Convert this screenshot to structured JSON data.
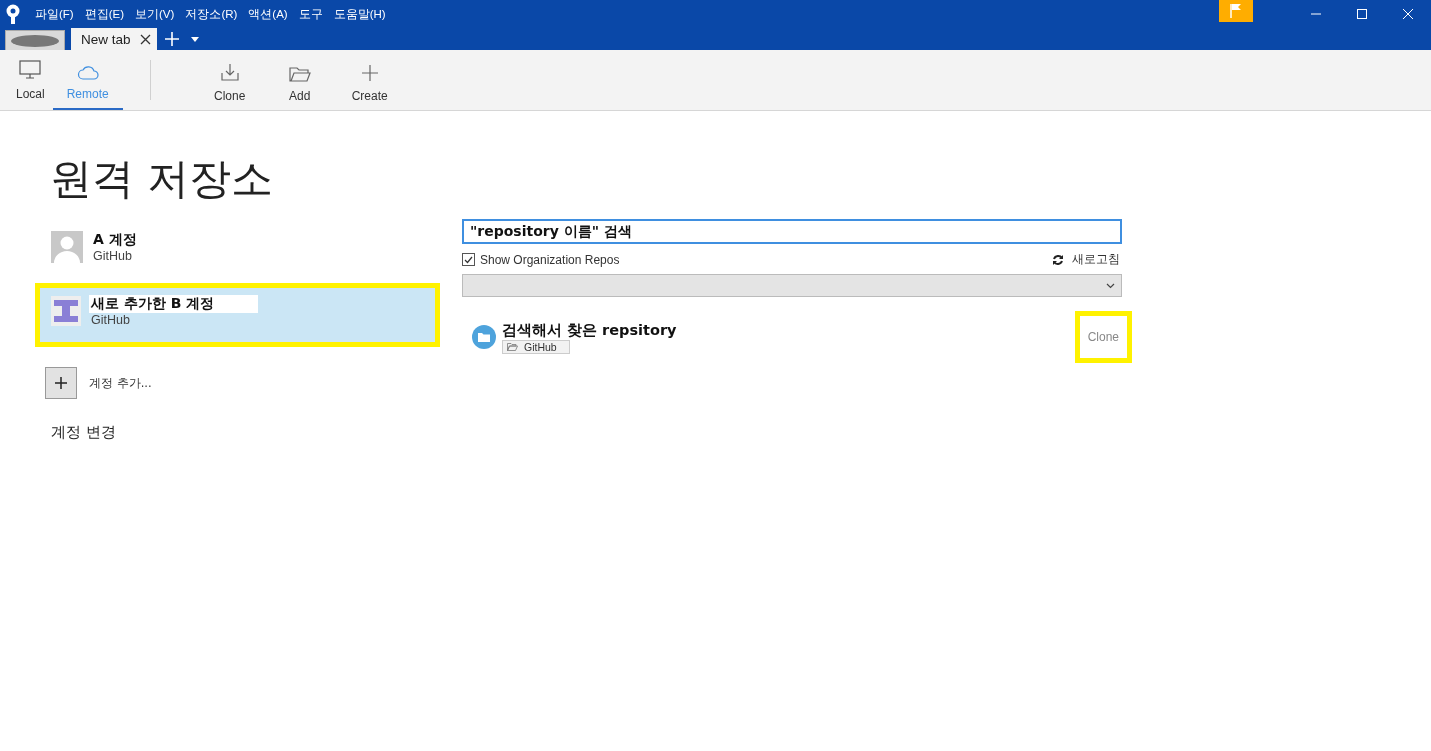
{
  "menu": [
    "파일(F)",
    "편집(E)",
    "보기(V)",
    "저장소(R)",
    "액션(A)",
    "도구",
    "도움말(H)"
  ],
  "tabs": [
    {
      "label": "New tab",
      "selected": true
    }
  ],
  "toolbar": {
    "views": [
      {
        "label": "Local",
        "selected": false
      },
      {
        "label": "Remote",
        "selected": true
      }
    ],
    "actions": [
      {
        "label": "Clone"
      },
      {
        "label": "Add"
      },
      {
        "label": "Create"
      }
    ]
  },
  "title": "원격 저장소",
  "accounts": [
    {
      "name": "A 계정",
      "service": "GitHub",
      "selected": false,
      "highlighted": false
    },
    {
      "name": "새로 추가한 B 계정",
      "service": "GitHub",
      "selected": true,
      "highlighted": true
    }
  ],
  "add_account": "계정 추가...",
  "change_account": "계정 변경",
  "search": {
    "value": "\"repository 이름\" 검색"
  },
  "show_org_repos": {
    "label": "Show Organization Repos",
    "checked": true
  },
  "refresh": "새로고침",
  "repos": [
    {
      "name": "검색해서 찾은 repsitory",
      "tag": "GitHub",
      "action": "Clone",
      "highlighted": true
    }
  ]
}
